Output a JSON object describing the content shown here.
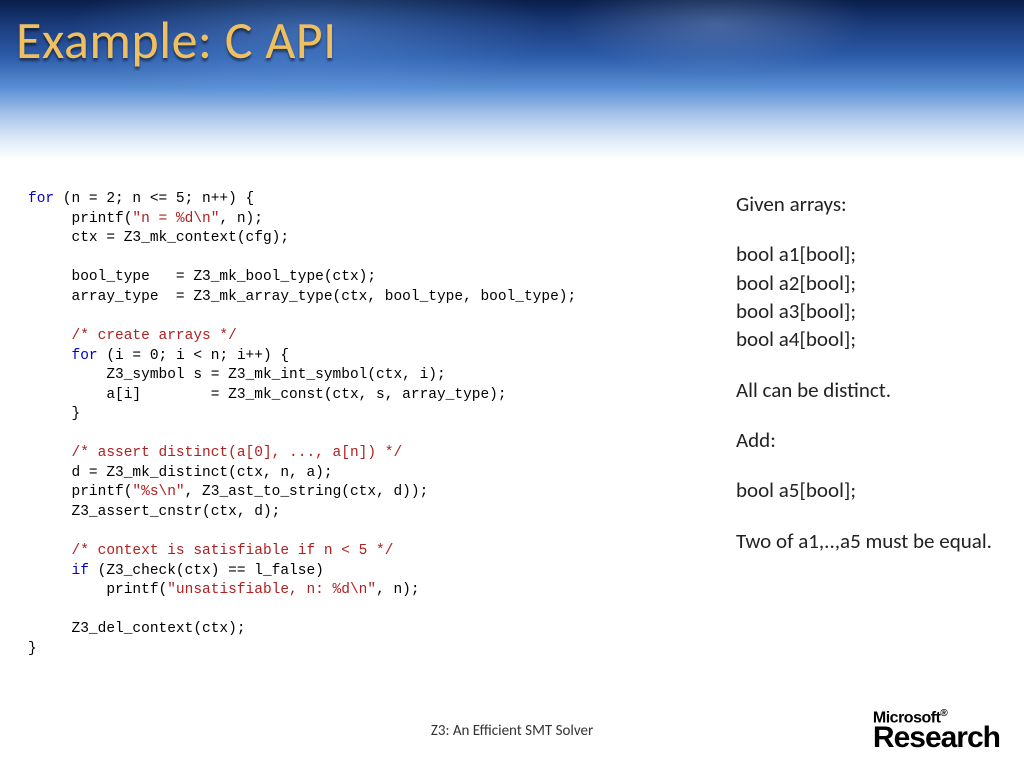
{
  "title": "Example: C API",
  "code": {
    "l01a": "for",
    "l01b": " (n = 2; n <= 5; n++) {",
    "l02a": "     printf(",
    "l02b": "\"n = %d\\n\"",
    "l02c": ", n);",
    "l03": "     ctx = Z3_mk_context(cfg);",
    "l04": " ",
    "l05": "     bool_type   = Z3_mk_bool_type(ctx);",
    "l06": "     array_type  = Z3_mk_array_type(ctx, bool_type, bool_type);",
    "l07": " ",
    "l08": "     /* create arrays */",
    "l09a": "     ",
    "l09b": "for",
    "l09c": " (i = 0; i < n; i++) {",
    "l10": "         Z3_symbol s = Z3_mk_int_symbol(ctx, i);",
    "l11": "         a[i]        = Z3_mk_const(ctx, s, array_type);",
    "l12": "     }",
    "l13": " ",
    "l14": "     /* assert distinct(a[0], ..., a[n]) */",
    "l15": "     d = Z3_mk_distinct(ctx, n, a);",
    "l16a": "     printf(",
    "l16b": "\"%s\\n\"",
    "l16c": ", Z3_ast_to_string(ctx, d));",
    "l17": "     Z3_assert_cnstr(ctx, d);",
    "l18": " ",
    "l19": "     /* context is satisfiable if n < 5 */",
    "l20a": "     ",
    "l20b": "if",
    "l20c": " (Z3_check(ctx) == l_false)",
    "l21a": "         printf(",
    "l21b": "\"unsatisfiable, n: %d\\n\"",
    "l21c": ", n);",
    "l22": " ",
    "l23": "     Z3_del_context(ctx);",
    "l24": "}"
  },
  "notes": {
    "p1": "Given arrays:",
    "p2": "bool a1[bool];\nbool a2[bool];\nbool a3[bool];\nbool a4[bool];",
    "p3": "All can be distinct.",
    "p4": "Add:",
    "p5": "bool a5[bool];",
    "p6": "Two of a1,..,a5 must be equal."
  },
  "footer": "Z3: An Efficient SMT Solver",
  "logo": {
    "ms": "Microsoft",
    "rs": "Research"
  }
}
